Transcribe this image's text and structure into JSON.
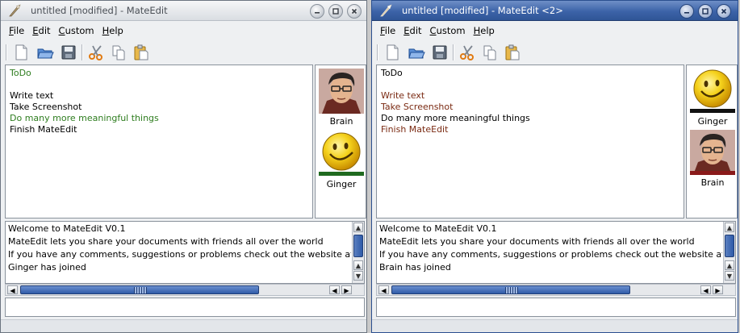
{
  "windows": [
    {
      "title": "untitled [modified] - MateEdit",
      "active": false,
      "menu": [
        "File",
        "Edit",
        "Custom",
        "Help"
      ],
      "toolbar": [
        "new-document-icon",
        "open-folder-icon",
        "save-icon",
        "cut-icon",
        "copy-icon",
        "paste-icon"
      ],
      "document_lines": [
        {
          "text": "ToDo",
          "color": "#2e7d1f"
        },
        {
          "text": "",
          "color": "#000000"
        },
        {
          "text": "Write text",
          "color": "#000000"
        },
        {
          "text": "Take Screenshot",
          "color": "#000000"
        },
        {
          "text": "Do many more meaningful things",
          "color": "#2e7d1f"
        },
        {
          "text": "Finish MateEdit",
          "color": "#000000"
        }
      ],
      "users": [
        {
          "name": "Brain",
          "avatar": "man-with-glasses-avatar",
          "bar_color": ""
        },
        {
          "name": "Ginger",
          "avatar": "smiley-face-avatar",
          "bar_color": "#1f6a1f"
        }
      ],
      "chat": [
        "Welcome to MateEdit V0.1",
        "MateEdit lets you share your documents with friends all over the world",
        "If you have any comments, suggestions or problems check out the website at mateedit.sourceforge.net",
        "Ginger has joined"
      ]
    },
    {
      "title": "untitled [modified] - MateEdit <2>",
      "active": true,
      "menu": [
        "File",
        "Edit",
        "Custom",
        "Help"
      ],
      "toolbar": [
        "new-document-icon",
        "open-folder-icon",
        "save-icon",
        "cut-icon",
        "copy-icon",
        "paste-icon"
      ],
      "document_lines": [
        {
          "text": "ToDo",
          "color": "#000000"
        },
        {
          "text": "",
          "color": "#000000"
        },
        {
          "text": "Write text",
          "color": "#7a2a12"
        },
        {
          "text": "Take Screenshot",
          "color": "#7a2a12"
        },
        {
          "text": "Do many more meaningful things",
          "color": "#000000"
        },
        {
          "text": "Finish MateEdit",
          "color": "#7a2a12"
        }
      ],
      "users": [
        {
          "name": "Ginger",
          "avatar": "smiley-face-avatar",
          "bar_color": "#111111"
        },
        {
          "name": "Brain",
          "avatar": "man-with-glasses-avatar",
          "bar_color": "#8a1a1a"
        }
      ],
      "chat": [
        "Welcome to MateEdit V0.1",
        "MateEdit lets you share your documents with friends all over the world",
        "If you have any comments, suggestions or problems check out the website at mateedit.sourceforge.net",
        "Brain has joined"
      ]
    }
  ]
}
